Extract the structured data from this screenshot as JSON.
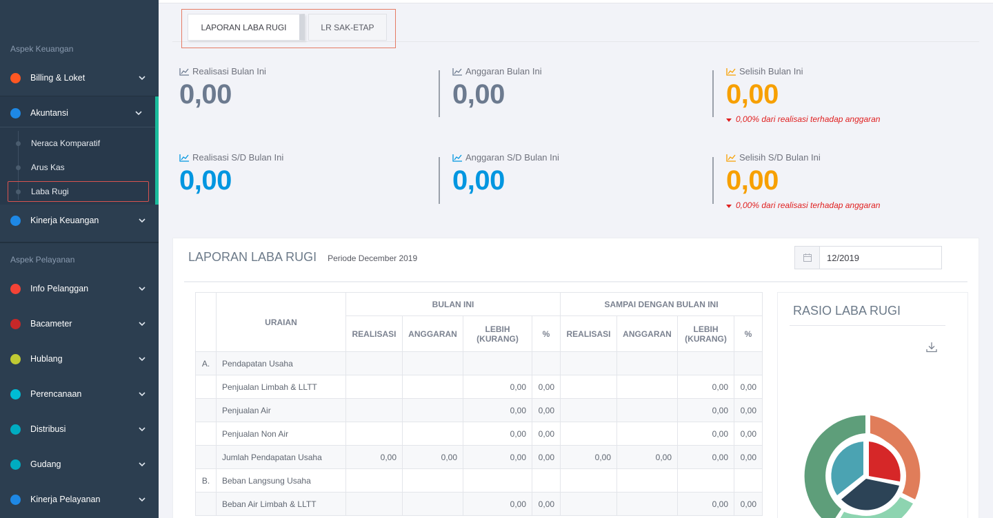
{
  "sidebar": {
    "section_keuangan": "Aspek Keuangan",
    "section_pelayanan": "Aspek Pelayanan",
    "billing": "Billing & Loket",
    "akuntansi": "Akuntansi",
    "sub_neraca": "Neraca Komparatif",
    "sub_aruskas": "Arus Kas",
    "sub_labarugi": "Laba Rugi",
    "kinerja_keuangan": "Kinerja Keuangan",
    "info_pelanggan": "Info Pelanggan",
    "bacameter": "Bacameter",
    "hublang": "Hublang",
    "perencanaan": "Perencanaan",
    "distribusi": "Distribusi",
    "gudang": "Gudang",
    "kinerja_pelayanan": "Kinerja Pelayanan",
    "colors": {
      "billing": "#ff5722",
      "akuntansi": "#1e88e5",
      "kinerja_keuangan": "#1e88e5",
      "info_pelanggan": "#f44336",
      "bacameter": "#c62828",
      "hublang": "#c0ca33",
      "perencanaan": "#00bcd4",
      "distribusi": "#00acc1",
      "gudang": "#00acc1",
      "kinerja_pelayanan": "#1e88e5"
    }
  },
  "tabs": {
    "laporan": "LAPORAN LABA RUGI",
    "sak_etap": "LR SAK-ETAP"
  },
  "stats": {
    "realisasi_bulan": {
      "label": "Realisasi Bulan Ini",
      "value": "0,00"
    },
    "anggaran_bulan": {
      "label": "Anggaran Bulan Ini",
      "value": "0,00"
    },
    "selisih_bulan": {
      "label": "Selisih Bulan Ini",
      "value": "0,00",
      "note": "0,00% dari realisasi terhadap anggaran"
    },
    "realisasi_sd": {
      "label": "Realisasi S/D Bulan Ini",
      "value": "0,00"
    },
    "anggaran_sd": {
      "label": "Anggaran S/D Bulan Ini",
      "value": "0,00"
    },
    "selisih_sd": {
      "label": "Selisih S/D Bulan Ini",
      "value": "0,00",
      "note": "0,00% dari realisasi terhadap anggaran"
    },
    "colors": {
      "gray": "#6c7a8f",
      "blue": "#0096e0",
      "orange": "#f7a000"
    }
  },
  "report": {
    "title": "LAPORAN LABA RUGI",
    "periode": "Periode December 2019",
    "date_value": "12/2019",
    "headers": {
      "uraian": "URAIAN",
      "bulan_ini": "BULAN INI",
      "sampai": "SAMPAI DENGAN BULAN INI",
      "realisasi": "REALISASI",
      "anggaran": "ANGGARAN",
      "lebih": "LEBIH (KURANG)",
      "pct": "%"
    },
    "rows": [
      {
        "idx": "A.",
        "label": "Pendapatan Usaha",
        "cells": [
          "",
          "",
          "",
          "",
          "",
          "",
          "",
          ""
        ]
      },
      {
        "idx": "",
        "label": "Penjualan Limbah & LLTT",
        "cells": [
          "",
          "",
          "0,00",
          "0,00",
          "",
          "",
          "0,00",
          "0,00"
        ]
      },
      {
        "idx": "",
        "label": "Penjualan Air",
        "cells": [
          "",
          "",
          "0,00",
          "0,00",
          "",
          "",
          "0,00",
          "0,00"
        ]
      },
      {
        "idx": "",
        "label": "Penjualan Non Air",
        "cells": [
          "",
          "",
          "0,00",
          "0,00",
          "",
          "",
          "0,00",
          "0,00"
        ]
      },
      {
        "idx": "",
        "label": "Jumlah Pendapatan Usaha",
        "cells": [
          "0,00",
          "0,00",
          "0,00",
          "0,00",
          "0,00",
          "0,00",
          "0,00",
          "0,00"
        ]
      },
      {
        "idx": "B.",
        "label": "Beban Langsung Usaha",
        "cells": [
          "",
          "",
          "",
          "",
          "",
          "",
          "",
          ""
        ]
      },
      {
        "idx": "",
        "label": "Beban Air Limbah & LLTT",
        "cells": [
          "",
          "",
          "0,00",
          "0,00",
          "",
          "",
          "0,00",
          "0,00"
        ]
      }
    ]
  },
  "ratio": {
    "title": "RASIO LABA RUGI"
  }
}
